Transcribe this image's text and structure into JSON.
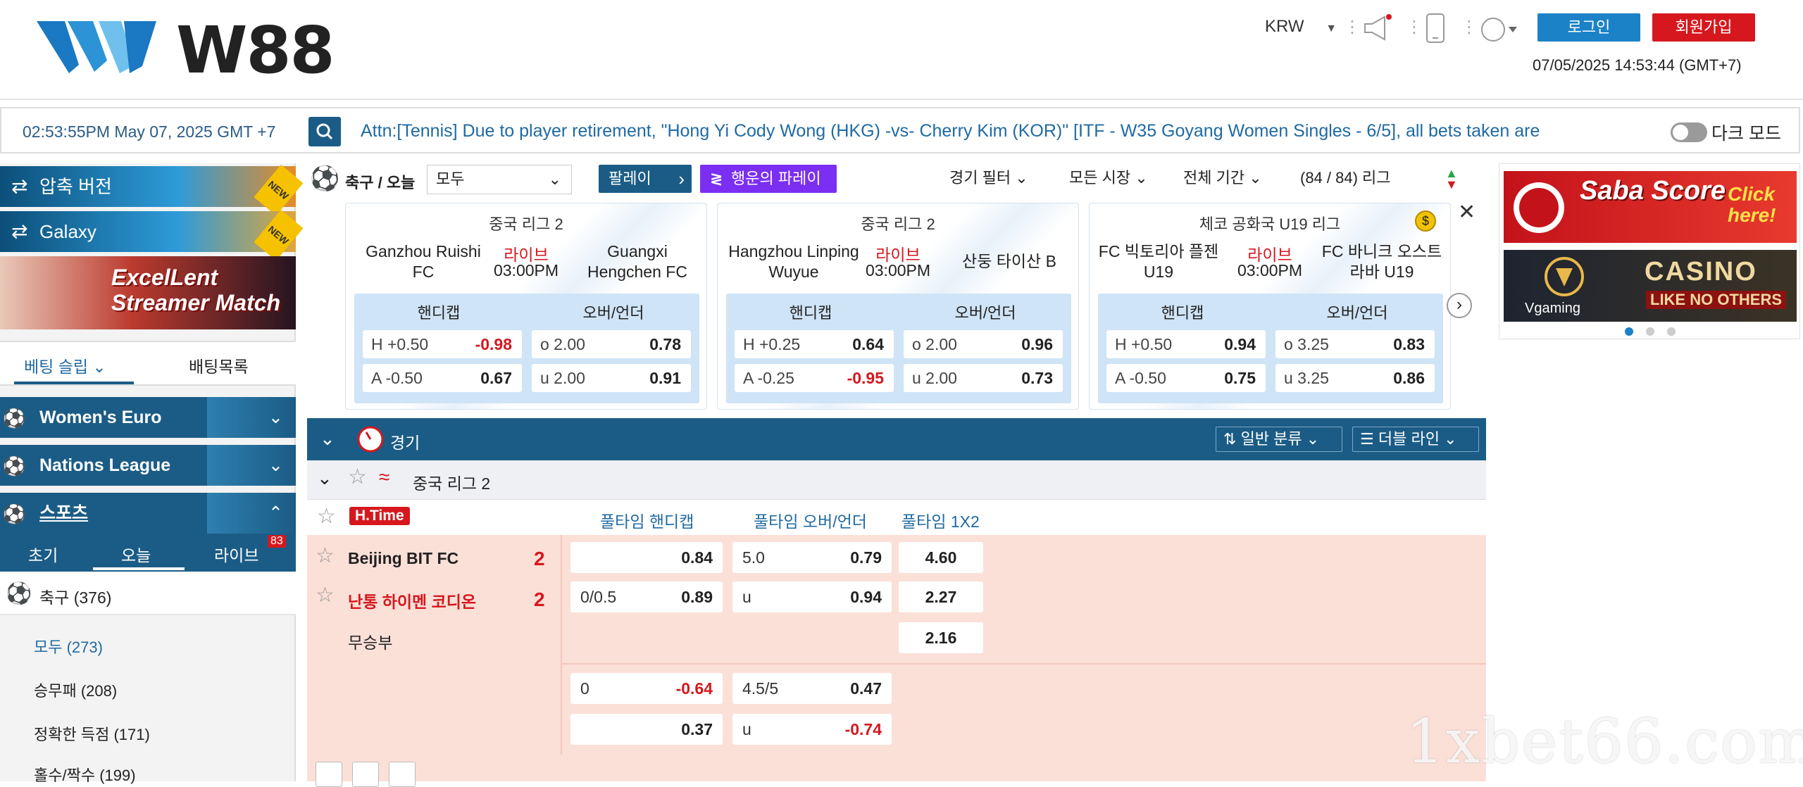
{
  "header": {
    "brand": "W88",
    "currency": "KRW",
    "login_label": "로그인",
    "join_label": "회원가입",
    "datetime": "07/05/2025 14:53:44 (GMT+7)"
  },
  "ticker": {
    "time": "02:53:55PM May 07, 2025 GMT +7",
    "message": "Attn:[Tennis] Due to player retirement, \"Hong Yi Cody Wong (HKG) -vs- Cherry Kim (KOR)\" [ITF - W35 Goyang Women Singles - 6/5], all bets taken are",
    "dark_mode_label": "다크 모드"
  },
  "sidebar": {
    "promo_zip": "압축 버전",
    "promo_galaxy": "Galaxy",
    "new_badge": "NEW",
    "streamer_text": "ExcelLent Streamer Match",
    "betslip_tab": "베팅 슬립",
    "betlist_tab": "배팅목록",
    "womens_euro": "Women's Euro",
    "nations_league": "Nations League",
    "sports": "스포츠",
    "tabs": {
      "early": "초기",
      "today": "오늘",
      "live": "라이브",
      "live_count": "83"
    },
    "soccer": "축구",
    "soccer_count": "(376)",
    "markets": [
      {
        "label": "모두",
        "count": "(273)"
      },
      {
        "label": "승무패",
        "count": "(208)"
      },
      {
        "label": "정확한 득점",
        "count": "(171)"
      },
      {
        "label": "홀수/짝수",
        "count": "(199)"
      }
    ]
  },
  "topbar": {
    "title": "축구 / 오늘",
    "select_value": "모두",
    "parlay": "팔레이",
    "lucky_parlay": "행운의 파레이",
    "game_filter": "경기 필터",
    "all_markets": "모든 시장",
    "full_time": "전체 기간",
    "league_count": "(84 / 84) 리그"
  },
  "cards": [
    {
      "league": "중국 리그 2",
      "home": "Ganzhou Ruishi FC",
      "away": "Guangxi Hengchen FC",
      "live": "라이브",
      "time": "03:00PM",
      "hdp_label": "핸디캡",
      "ou_label": "오버/언더",
      "h": {
        "l": "H +0.50",
        "r": "-0.98"
      },
      "a": {
        "l": "A -0.50",
        "r": "0.67"
      },
      "o": {
        "l": "o 2.00",
        "r": "0.78"
      },
      "u": {
        "l": "u 2.00",
        "r": "0.91"
      }
    },
    {
      "league": "중국 리그 2",
      "home": "Hangzhou Linping Wuyue",
      "away": "산둥 타이산 B",
      "live": "라이브",
      "time": "03:00PM",
      "hdp_label": "핸디캡",
      "ou_label": "오버/언더",
      "h": {
        "l": "H +0.25",
        "r": "0.64"
      },
      "a": {
        "l": "A -0.25",
        "r": "-0.95"
      },
      "o": {
        "l": "o 2.00",
        "r": "0.96"
      },
      "u": {
        "l": "u 2.00",
        "r": "0.73"
      }
    },
    {
      "league": "체코 공화국 U19 리그",
      "home": "FC 빅토리아 플젠 U19",
      "away": "FC 바니크 오스트라바 U19",
      "live": "라이브",
      "time": "03:00PM",
      "hdp_label": "핸디캡",
      "ou_label": "오버/언더",
      "h": {
        "l": "H +0.50",
        "r": "0.94"
      },
      "a": {
        "l": "A -0.50",
        "r": "0.75"
      },
      "o": {
        "l": "o 3.25",
        "r": "0.83"
      },
      "u": {
        "l": "u 3.25",
        "r": "0.86"
      }
    }
  ],
  "banners": {
    "saba": "Saba Score",
    "saba_click": "Click here!",
    "casino": "CASINO",
    "casino_sub": "LIKE NO OTHERS",
    "vgaming": "Vgaming"
  },
  "games": {
    "title": "경기",
    "sort": "일반 분류",
    "lines": "더블 라인",
    "league": "중국 리그 2",
    "htime": "H.Time",
    "col_hdp": "풀타임 핸디캡",
    "col_ou": "풀타임 오버/언더",
    "col_1x2": "풀타임 1X2",
    "home": "Beijing BIT FC",
    "away": "난통 하이멘 코디온",
    "draw": "무승부",
    "home_score": "2",
    "away_score": "2",
    "rows": {
      "r1_hdp": "0.84",
      "r1_ou_l": "5.0",
      "r1_ou_r": "0.79",
      "r1_1x2": "4.60",
      "r2_hdp_l": "0/0.5",
      "r2_hdp_r": "0.89",
      "r2_ou_l": "u",
      "r2_ou_r": "0.94",
      "r2_1x2": "2.27",
      "r3_1x2": "2.16",
      "r4_hdp_l": "0",
      "r4_hdp_r": "-0.64",
      "r4_ou_l": "4.5/5",
      "r4_ou_r": "0.47",
      "r5_hdp_r": "0.37",
      "r5_ou_l": "u",
      "r5_ou_r": "-0.74"
    }
  },
  "watermark": "1xbet66.com"
}
